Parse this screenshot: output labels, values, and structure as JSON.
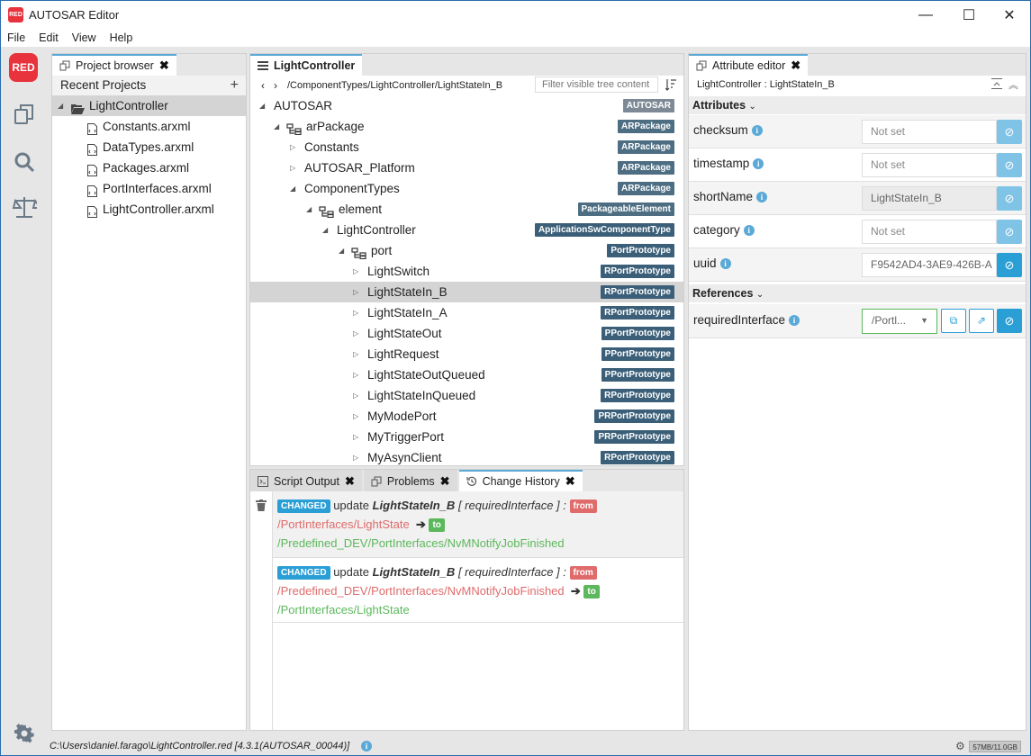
{
  "window": {
    "logo": "RED",
    "title": "AUTOSAR Editor",
    "controls": {
      "minimize": "—",
      "maximize": "☐",
      "close": "✕"
    }
  },
  "menu": [
    "File",
    "Edit",
    "View",
    "Help"
  ],
  "rail": {
    "logo": "RED",
    "icons": [
      "files-icon",
      "search-icon",
      "scale-icon",
      "gear-icon"
    ]
  },
  "project_browser": {
    "tab_label": "Project browser",
    "recent_label": "Recent Projects",
    "add": "+",
    "project": "LightController",
    "files": [
      "Constants.arxml",
      "DataTypes.arxml",
      "Packages.arxml",
      "PortInterfaces.arxml",
      "LightController.arxml"
    ]
  },
  "tree_editor": {
    "tab_label": "LightController",
    "breadcrumb": "/ComponentTypes/LightController/LightStateIn_B",
    "filter_placeholder": "Filter visible tree content",
    "rows": [
      {
        "label": "AUTOSAR",
        "badge": "AUTOSAR",
        "kind": "autosar",
        "twisty": "▲"
      },
      {
        "label": "arPackage",
        "badge": "ARPackage",
        "kind": "arpkg",
        "twisty": "▲"
      },
      {
        "label": "Constants",
        "badge": "ARPackage",
        "kind": "arpkg",
        "twisty": "▷"
      },
      {
        "label": "AUTOSAR_Platform",
        "badge": "ARPackage",
        "kind": "arpkg",
        "twisty": "▷"
      },
      {
        "label": "ComponentTypes",
        "badge": "ARPackage",
        "kind": "arpkg",
        "twisty": "▲"
      },
      {
        "label": "element",
        "badge": "PackageableElement",
        "kind": "pkgel",
        "twisty": "▲"
      },
      {
        "label": "LightController",
        "badge": "ApplicationSwComponentType",
        "kind": "appsw",
        "twisty": "▲"
      },
      {
        "label": "port",
        "badge": "PortPrototype",
        "kind": "port",
        "twisty": "▲"
      },
      {
        "label": "LightSwitch",
        "badge": "RPortPrototype",
        "kind": "port",
        "twisty": "▷"
      },
      {
        "label": "LightStateIn_B",
        "badge": "RPortPrototype",
        "kind": "port",
        "twisty": "▷"
      },
      {
        "label": "LightStateIn_A",
        "badge": "RPortPrototype",
        "kind": "port",
        "twisty": "▷"
      },
      {
        "label": "LightStateOut",
        "badge": "PPortPrototype",
        "kind": "port",
        "twisty": "▷"
      },
      {
        "label": "LightRequest",
        "badge": "PPortPrototype",
        "kind": "port",
        "twisty": "▷"
      },
      {
        "label": "LightStateOutQueued",
        "badge": "PPortPrototype",
        "kind": "port",
        "twisty": "▷"
      },
      {
        "label": "LightStateInQueued",
        "badge": "RPortPrototype",
        "kind": "port",
        "twisty": "▷"
      },
      {
        "label": "MyModePort",
        "badge": "PRPortPrototype",
        "kind": "port",
        "twisty": "▷"
      },
      {
        "label": "MyTriggerPort",
        "badge": "PRPortPrototype",
        "kind": "port",
        "twisty": "▷"
      },
      {
        "label": "MyAsynClient",
        "badge": "RPortPrototype",
        "kind": "port",
        "twisty": "▷"
      }
    ]
  },
  "console": {
    "tabs": [
      "Script Output",
      "Problems",
      "Change History"
    ],
    "entries": [
      {
        "badge": "CHANGED",
        "verb": "update",
        "element": "LightStateIn_B",
        "attr": "[ requiredInterface ] :",
        "from_label": "from",
        "from": "/PortInterfaces/LightState",
        "to_label": "to",
        "to": "/Predefined_DEV/PortInterfaces/NvMNotifyJobFinished"
      },
      {
        "badge": "CHANGED",
        "verb": "update",
        "element": "LightStateIn_B",
        "attr": "[ requiredInterface ] :",
        "from_label": "from",
        "from": "/Predefined_DEV/PortInterfaces/NvMNotifyJobFinished",
        "to_label": "to",
        "to": "/PortInterfaces/LightState"
      }
    ]
  },
  "attribute_editor": {
    "tab_label": "Attribute editor",
    "path": "LightController : LightStateIn_B",
    "attributes_label": "Attributes",
    "references_label": "References",
    "attributes": [
      {
        "name": "checksum",
        "value": "Not set"
      },
      {
        "name": "timestamp",
        "value": "Not set"
      },
      {
        "name": "shortName",
        "value": "LightStateIn_B"
      },
      {
        "name": "category",
        "value": "Not set"
      },
      {
        "name": "uuid",
        "value": "F9542AD4-3AE9-426B-A"
      }
    ],
    "references": [
      {
        "name": "requiredInterface",
        "value": "/Portl..."
      }
    ]
  },
  "status": {
    "path": "C:\\Users\\daniel.farago\\LightController.red [4.3.1(AUTOSAR_00044)]",
    "memory": "57MB/11.0GB"
  }
}
